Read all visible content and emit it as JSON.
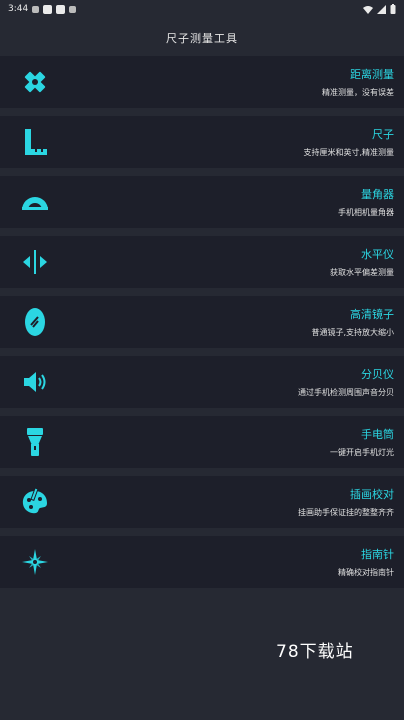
{
  "status": {
    "time": "3:44"
  },
  "app": {
    "title": "尺子测量工具"
  },
  "items": [
    {
      "title": "距离测量",
      "sub": "精准测量，没有误差",
      "icon": "distance-ruler-icon"
    },
    {
      "title": "尺子",
      "sub": "支持厘米和英寸,精准测量",
      "icon": "ruler-icon"
    },
    {
      "title": "量角器",
      "sub": "手机相机量角器",
      "icon": "protractor-icon"
    },
    {
      "title": "水平仪",
      "sub": "获取水平偏差测量",
      "icon": "level-icon"
    },
    {
      "title": "高清镜子",
      "sub": "普通镜子,支持放大缩小",
      "icon": "mirror-icon"
    },
    {
      "title": "分贝仪",
      "sub": "通过手机检测周围声音分贝",
      "icon": "decibel-icon"
    },
    {
      "title": "手电筒",
      "sub": "一键开启手机灯光",
      "icon": "flashlight-icon"
    },
    {
      "title": "插画校对",
      "sub": "挂画助手保证挂的整整齐齐",
      "icon": "palette-icon"
    },
    {
      "title": "指南针",
      "sub": "精确校对指南针",
      "icon": "compass-icon"
    }
  ],
  "watermark": "78下载站",
  "colors": {
    "accent": "#2bd6e2",
    "background": "#262933",
    "card": "#1d1f2a"
  }
}
